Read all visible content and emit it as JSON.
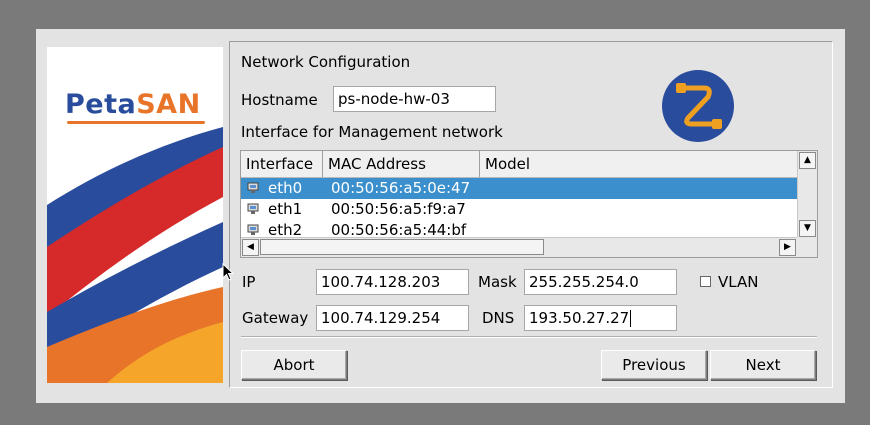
{
  "brand": {
    "logo_pre": "Peta",
    "logo_post": "SAN"
  },
  "form": {
    "section_title": "Network Configuration",
    "hostname_label": "Hostname",
    "hostname_value": "ps-node-hw-03",
    "interface_heading": "Interface for Management network"
  },
  "table": {
    "columns": [
      "Interface",
      "MAC Address",
      "Model"
    ],
    "rows": [
      {
        "interface": "eth0",
        "mac": "00:50:56:a5:0e:47",
        "model": "",
        "selected": true
      },
      {
        "interface": "eth1",
        "mac": "00:50:56:a5:f9:a7",
        "model": "",
        "selected": false
      },
      {
        "interface": "eth2",
        "mac": "00:50:56:a5:44:bf",
        "model": "",
        "selected": false
      }
    ]
  },
  "network": {
    "ip_label": "IP",
    "ip_value": "100.74.128.203",
    "mask_label": "Mask",
    "mask_value": "255.255.254.0",
    "vlan_label": "VLAN",
    "vlan_checked": false,
    "gateway_label": "Gateway",
    "gateway_value": "100.74.129.254",
    "dns_label": "DNS",
    "dns_value": "193.50.27.27"
  },
  "buttons": {
    "abort": "Abort",
    "previous": "Previous",
    "next": "Next"
  },
  "colors": {
    "selection": "#3a8fcc",
    "brand_blue": "#2a4c9c",
    "brand_orange": "#e8742a",
    "brand_red": "#d62a2a",
    "icon_circle": "#2a4c9c",
    "icon_cable": "#f0a020"
  },
  "icons": {
    "nic_row_icon": "network-card-icon",
    "header_icon": "network-cable-icon"
  }
}
